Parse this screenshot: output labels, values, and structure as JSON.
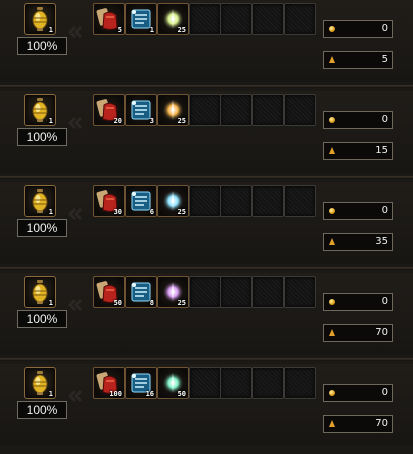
{
  "slots": [
    {
      "tool_count": "1",
      "success_rate": "100%",
      "materials": [
        {
          "icon": "red-ore-bag-icon",
          "count": "5"
        },
        {
          "icon": "blue-scroll-icon",
          "count": "1"
        },
        {
          "icon": "green-spirit-orb-icon",
          "count": "25",
          "color": "#d7f08a"
        }
      ],
      "gold_cost": "0",
      "fee": "5"
    },
    {
      "tool_count": "1",
      "success_rate": "100%",
      "materials": [
        {
          "icon": "red-ore-bag-icon",
          "count": "20"
        },
        {
          "icon": "blue-scroll-icon",
          "count": "3"
        },
        {
          "icon": "orange-spirit-orb-icon",
          "count": "25",
          "color": "#f5b44a"
        }
      ],
      "gold_cost": "0",
      "fee": "15"
    },
    {
      "tool_count": "1",
      "success_rate": "100%",
      "materials": [
        {
          "icon": "red-ore-bag-icon",
          "count": "30"
        },
        {
          "icon": "blue-scroll-icon",
          "count": "6"
        },
        {
          "icon": "cyan-spirit-orb-icon",
          "count": "25",
          "color": "#8fe3ff"
        }
      ],
      "gold_cost": "0",
      "fee": "35"
    },
    {
      "tool_count": "1",
      "success_rate": "100%",
      "materials": [
        {
          "icon": "red-ore-bag-icon",
          "count": "50"
        },
        {
          "icon": "blue-scroll-icon",
          "count": "8"
        },
        {
          "icon": "purple-spirit-orb-icon",
          "count": "25",
          "color": "#d69af0"
        }
      ],
      "gold_cost": "0",
      "fee": "70"
    },
    {
      "tool_count": "1",
      "success_rate": "100%",
      "materials": [
        {
          "icon": "red-ore-bag-icon",
          "count": "100"
        },
        {
          "icon": "blue-scroll-icon",
          "count": "16"
        },
        {
          "icon": "teal-spirit-orb-icon",
          "count": "50",
          "color": "#7ff0c8"
        }
      ],
      "gold_cost": "0",
      "fee": "70"
    }
  ],
  "icons": {
    "tool": "gold-oil-lamp-icon",
    "arrow": "double-chevron-left-icon",
    "gold": "gold-coin-icon",
    "fee": "ember-icon"
  }
}
